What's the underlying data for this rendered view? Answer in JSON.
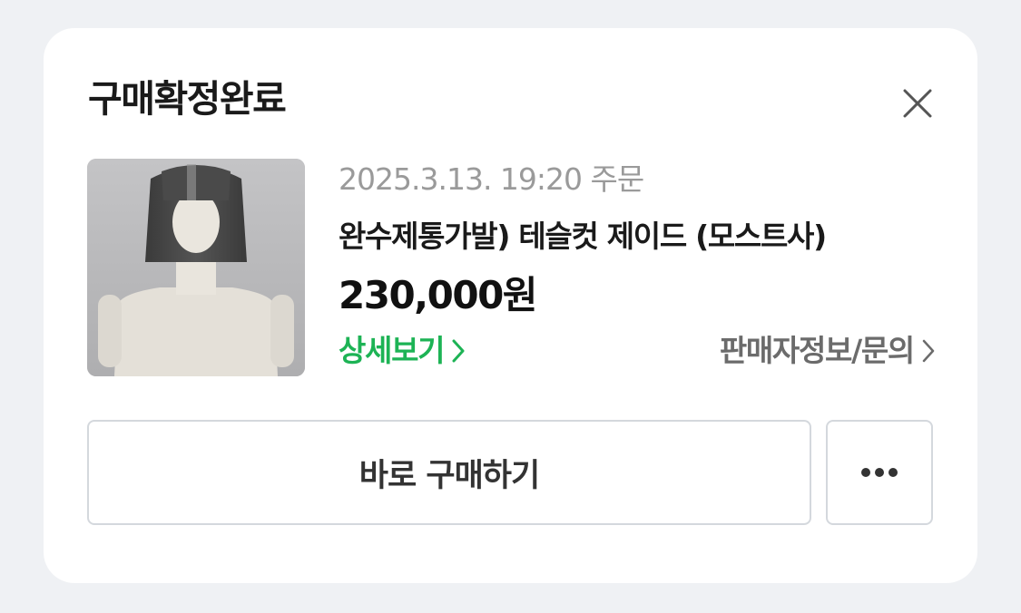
{
  "dialog": {
    "title": "구매확정완료",
    "close_icon": "close-icon"
  },
  "product": {
    "image_icon": "wig-mannequin-image",
    "order_date": "2025.3.13. 19:20 주문",
    "name": "완수제통가발) 테슬컷 제이드 (모스트사)",
    "price": "230,000원",
    "detail_link": "상세보기",
    "seller_link": "판매자정보/문의"
  },
  "actions": {
    "buy_again": "바로 구매하기",
    "more_icon": "more-dots-icon"
  },
  "colors": {
    "accent_green": "#1db355",
    "background": "#eff1f4",
    "card": "#ffffff",
    "border": "#d4d8dd"
  }
}
